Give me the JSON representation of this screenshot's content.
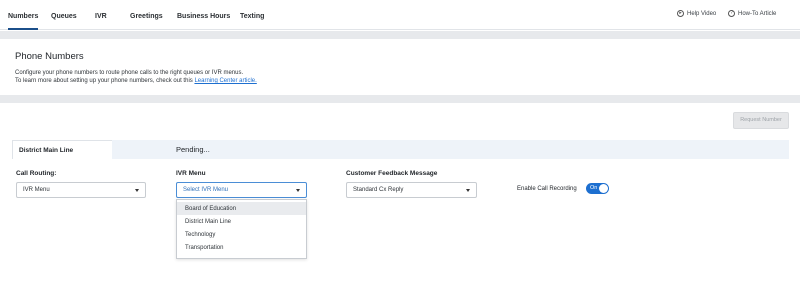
{
  "nav": {
    "tabs": [
      "Numbers",
      "Queues",
      "IVR",
      "Greetings",
      "Business Hours",
      "Texting"
    ],
    "help_video": "Help Video",
    "how_to": "How-To Article"
  },
  "header": {
    "title": "Phone Numbers",
    "desc_line1": "Configure your phone numbers to route phone calls to the right queues or IVR menus.",
    "desc_line2_prefix": "To learn more about setting up your phone numbers, check out this ",
    "desc_link": "Learning Center article."
  },
  "request_button": "Request Number",
  "line": {
    "name": "District Main Line",
    "status": "Pending..."
  },
  "form": {
    "call_routing_label": "Call Routing:",
    "call_routing_value": "IVR Menu",
    "ivr_menu_label": "IVR Menu",
    "ivr_menu_placeholder": "Select IVR Menu",
    "ivr_options": [
      "Board of Education",
      "District Main Line",
      "Technology",
      "Transportation"
    ],
    "feedback_label": "Customer Feedback Message",
    "feedback_value": "Standard Cx Reply",
    "recording_label": "Enable Call Recording",
    "recording_state": "On"
  },
  "colors": {
    "accent": "#1d6fd0",
    "nav_active": "#1b4f8a",
    "band": "#e7e9ec"
  }
}
